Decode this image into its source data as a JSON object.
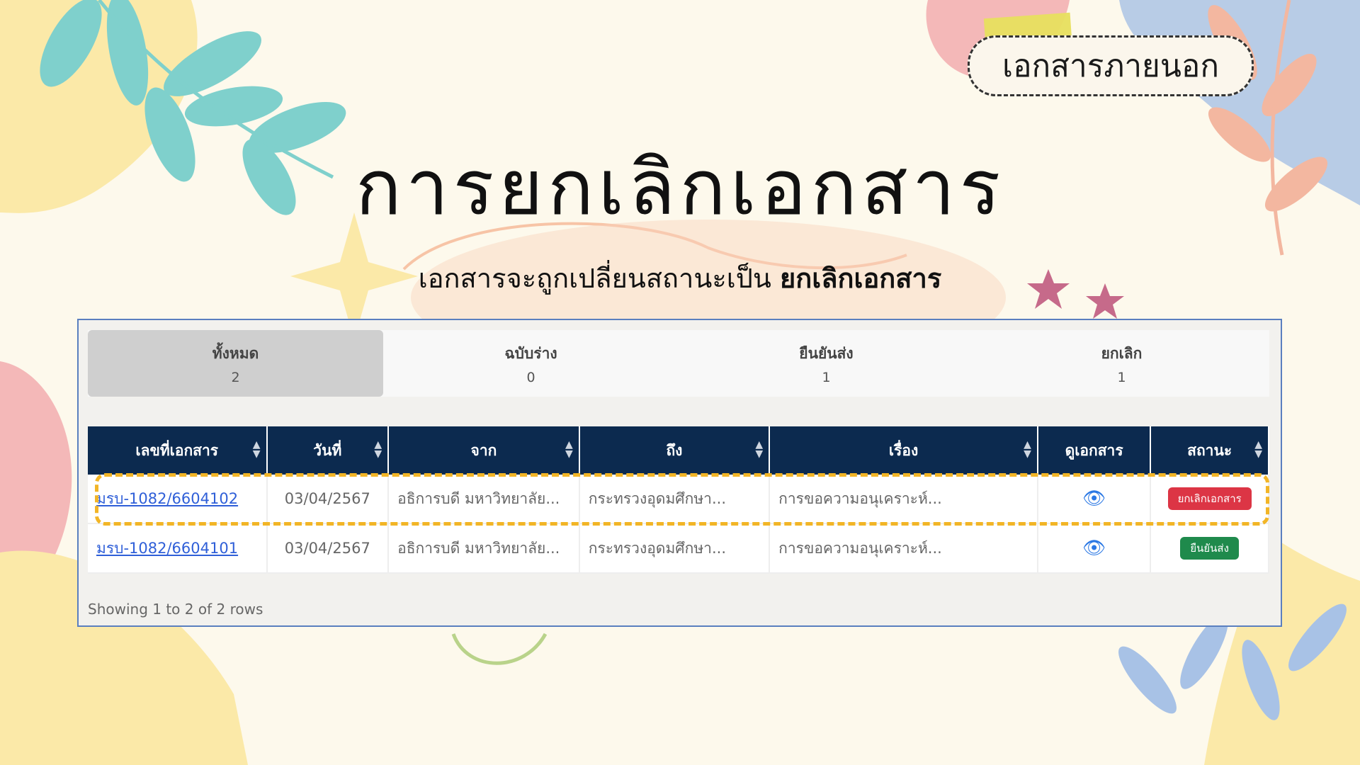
{
  "header_tag": "เอกสารภายนอก",
  "title": "การยกเลิกเอกสาร",
  "subtitle": {
    "prefix": "เอกสารจะถูกเปลี่ยนสถานะเป็น",
    "emphasis": "ยกเลิกเอกสาร"
  },
  "tabs": [
    {
      "label": "ทั้งหมด",
      "count": "2"
    },
    {
      "label": "ฉบับร่าง",
      "count": "0"
    },
    {
      "label": "ยืนยันส่ง",
      "count": "1"
    },
    {
      "label": "ยกเลิก",
      "count": "1"
    }
  ],
  "columns": [
    "เลขที่เอกสาร",
    "วันที่",
    "จาก",
    "ถึง",
    "เรื่อง",
    "ดูเอกสาร",
    "สถานะ"
  ],
  "rows": [
    {
      "doc_no": "มรบ-1082/6604102",
      "date": "03/04/2567",
      "from": "อธิการบดี มหาวิทยาลัย...",
      "to": "กระทรวงอุดมศึกษา...",
      "subject": "การขอความอนุเคราะห์...",
      "view_icon": "eye-icon",
      "status": "ยกเลิกเอกสาร",
      "status_color": "#dc3545"
    },
    {
      "doc_no": "มรบ-1082/6604101",
      "date": "03/04/2567",
      "from": "อธิการบดี มหาวิทยาลัย...",
      "to": "กระทรวงอุดมศึกษา...",
      "subject": "การขอความอนุเคราะห์...",
      "view_icon": "eye-icon",
      "status": "ยืนยันส่ง",
      "status_color": "#1f8a4c"
    }
  ],
  "footer": "Showing 1 to 2 of 2 rows",
  "colors": {
    "table_header": "#0c2a4f",
    "highlight": "#f2b526",
    "link": "#2f5fd8"
  }
}
